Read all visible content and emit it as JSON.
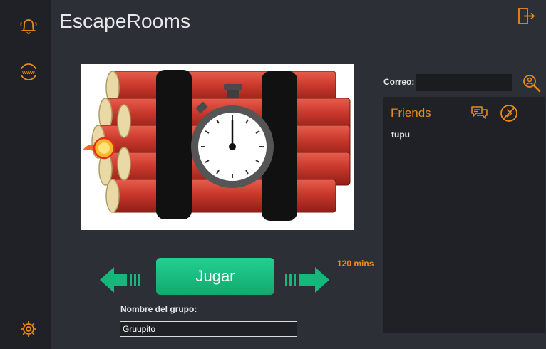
{
  "app": {
    "title": "EscapeRooms"
  },
  "colors": {
    "accent": "#e98a1a",
    "play_green": "#16b77a",
    "background": "#2d2f36",
    "sidebar": "#202126"
  },
  "sidebar": {
    "icons": [
      "bell-icon",
      "www-icon",
      "settings-icon"
    ]
  },
  "header": {
    "exit_icon": "exit-icon"
  },
  "game": {
    "image": "dynamite-timer-bomb",
    "play_label": "Jugar",
    "duration": "120 mins",
    "prev_icon": "arrow-left-icon",
    "next_icon": "arrow-right-icon"
  },
  "group": {
    "label": "Nombre del grupo:",
    "value": "Gruupito"
  },
  "search": {
    "label": "Correo:",
    "value": ""
  },
  "friends": {
    "title": "Friends",
    "items": [
      "tupu"
    ],
    "chat_icon": "chat-icon",
    "block_icon": "block-icon"
  }
}
